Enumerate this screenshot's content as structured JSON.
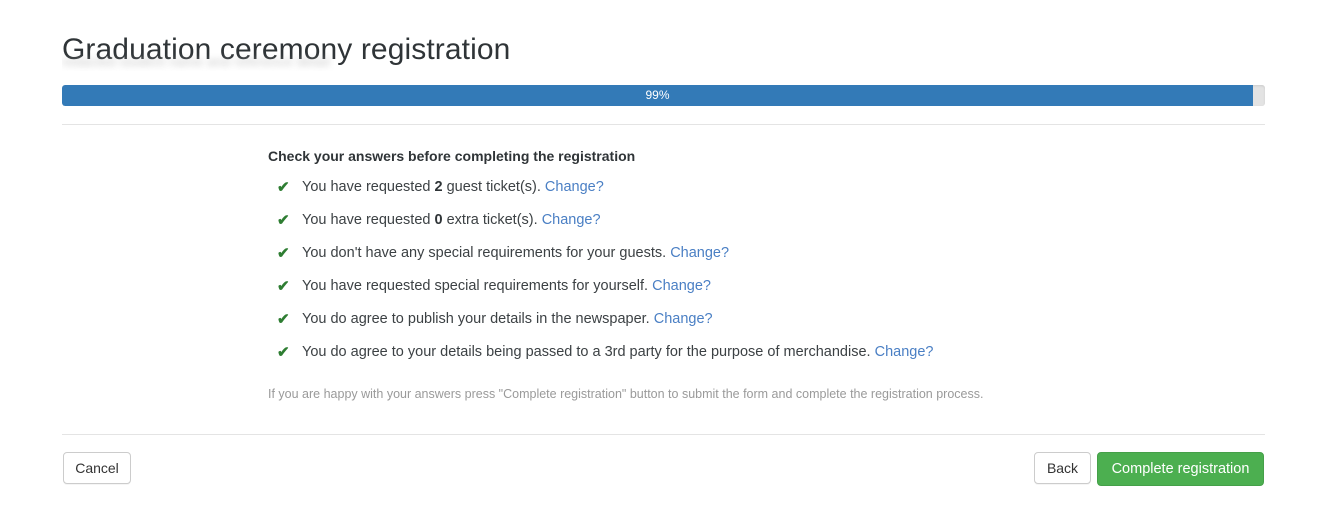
{
  "header": {
    "title": "Graduation ceremony registration",
    "subtitle_redacted": "redacted student name and reference detail"
  },
  "progress": {
    "percent_label": "99%",
    "percent_value": 99
  },
  "answers": {
    "heading": "Check your answers before completing the registration",
    "check_icon": "✔",
    "items": [
      {
        "text_before": "You have requested ",
        "strong": "2",
        "text_after": " guest ticket(s).",
        "link": "Change?"
      },
      {
        "text_before": "You have requested ",
        "strong": "0",
        "text_after": " extra ticket(s).",
        "link": "Change?"
      },
      {
        "text_before": "You don't have any special requirements for your guests.",
        "strong": "",
        "text_after": "",
        "link": "Change?"
      },
      {
        "text_before": "You have requested special requirements for yourself.",
        "strong": "",
        "text_after": "",
        "link": "Change?"
      },
      {
        "text_before": "You do agree to publish your details in the newspaper.",
        "strong": "",
        "text_after": "",
        "link": "Change?"
      },
      {
        "text_before": "You do agree to your details being passed to a 3rd party for the purpose of merchandise.",
        "strong": "",
        "text_after": "",
        "link": "Change?"
      }
    ],
    "help_note": "If you are happy with your answers press \"Complete registration\" button to submit the form and complete the registration process."
  },
  "footer": {
    "cancel_label": "Cancel",
    "back_label": "Back",
    "complete_label": "Complete registration"
  },
  "colors": {
    "progress_fill": "#337ab7",
    "progress_track": "#e3e3e3",
    "link": "#4a7fc4",
    "check": "#2e7d32",
    "primary_button": "#4caf50",
    "divider": "#e4e4e4",
    "title": "#2f3437"
  }
}
